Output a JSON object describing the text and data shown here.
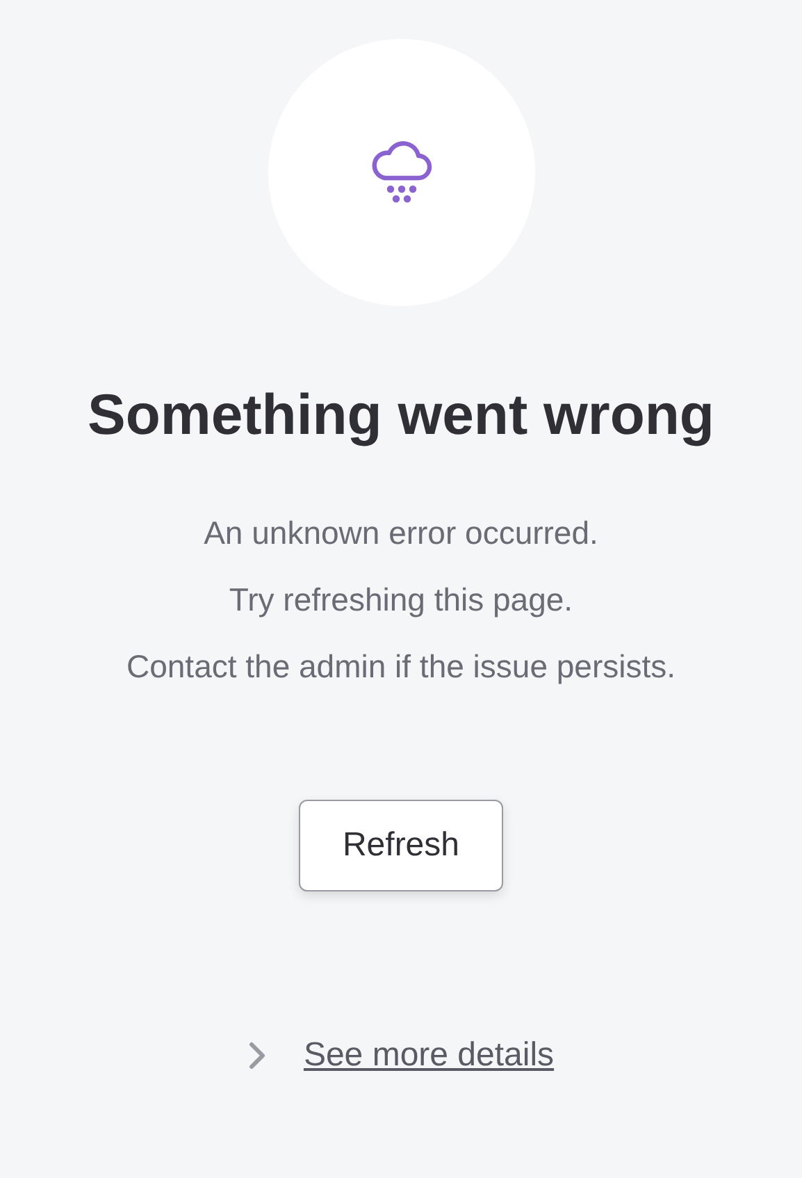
{
  "title": "Something went wrong",
  "messages": [
    "An unknown error occurred.",
    "Try refreshing this page.",
    "Contact the admin if the issue persists."
  ],
  "button": {
    "label": "Refresh"
  },
  "details": {
    "label": "See more details",
    "expanded": false
  }
}
